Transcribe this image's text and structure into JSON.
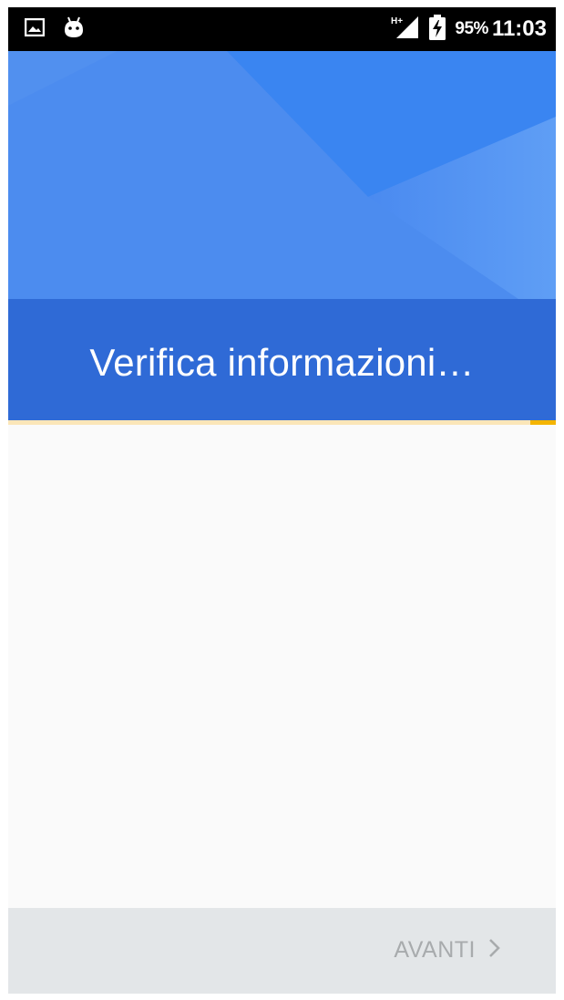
{
  "status_bar": {
    "left_icons": [
      "image-icon",
      "android-debug-icon"
    ],
    "network_label": "H+",
    "battery_percent": "95%",
    "time": "11:03"
  },
  "header": {
    "title": "Verifica informazioni…"
  },
  "progress": {
    "indeterminate": true
  },
  "footer": {
    "next_label": "AVANTI",
    "next_enabled": false
  },
  "colors": {
    "header_blue": "#4d8ef0",
    "title_band_blue": "#2f6ad6",
    "progress_accent": "#f4b400",
    "footer_bg": "#e3e6e8",
    "disabled_text": "#a8abad"
  }
}
